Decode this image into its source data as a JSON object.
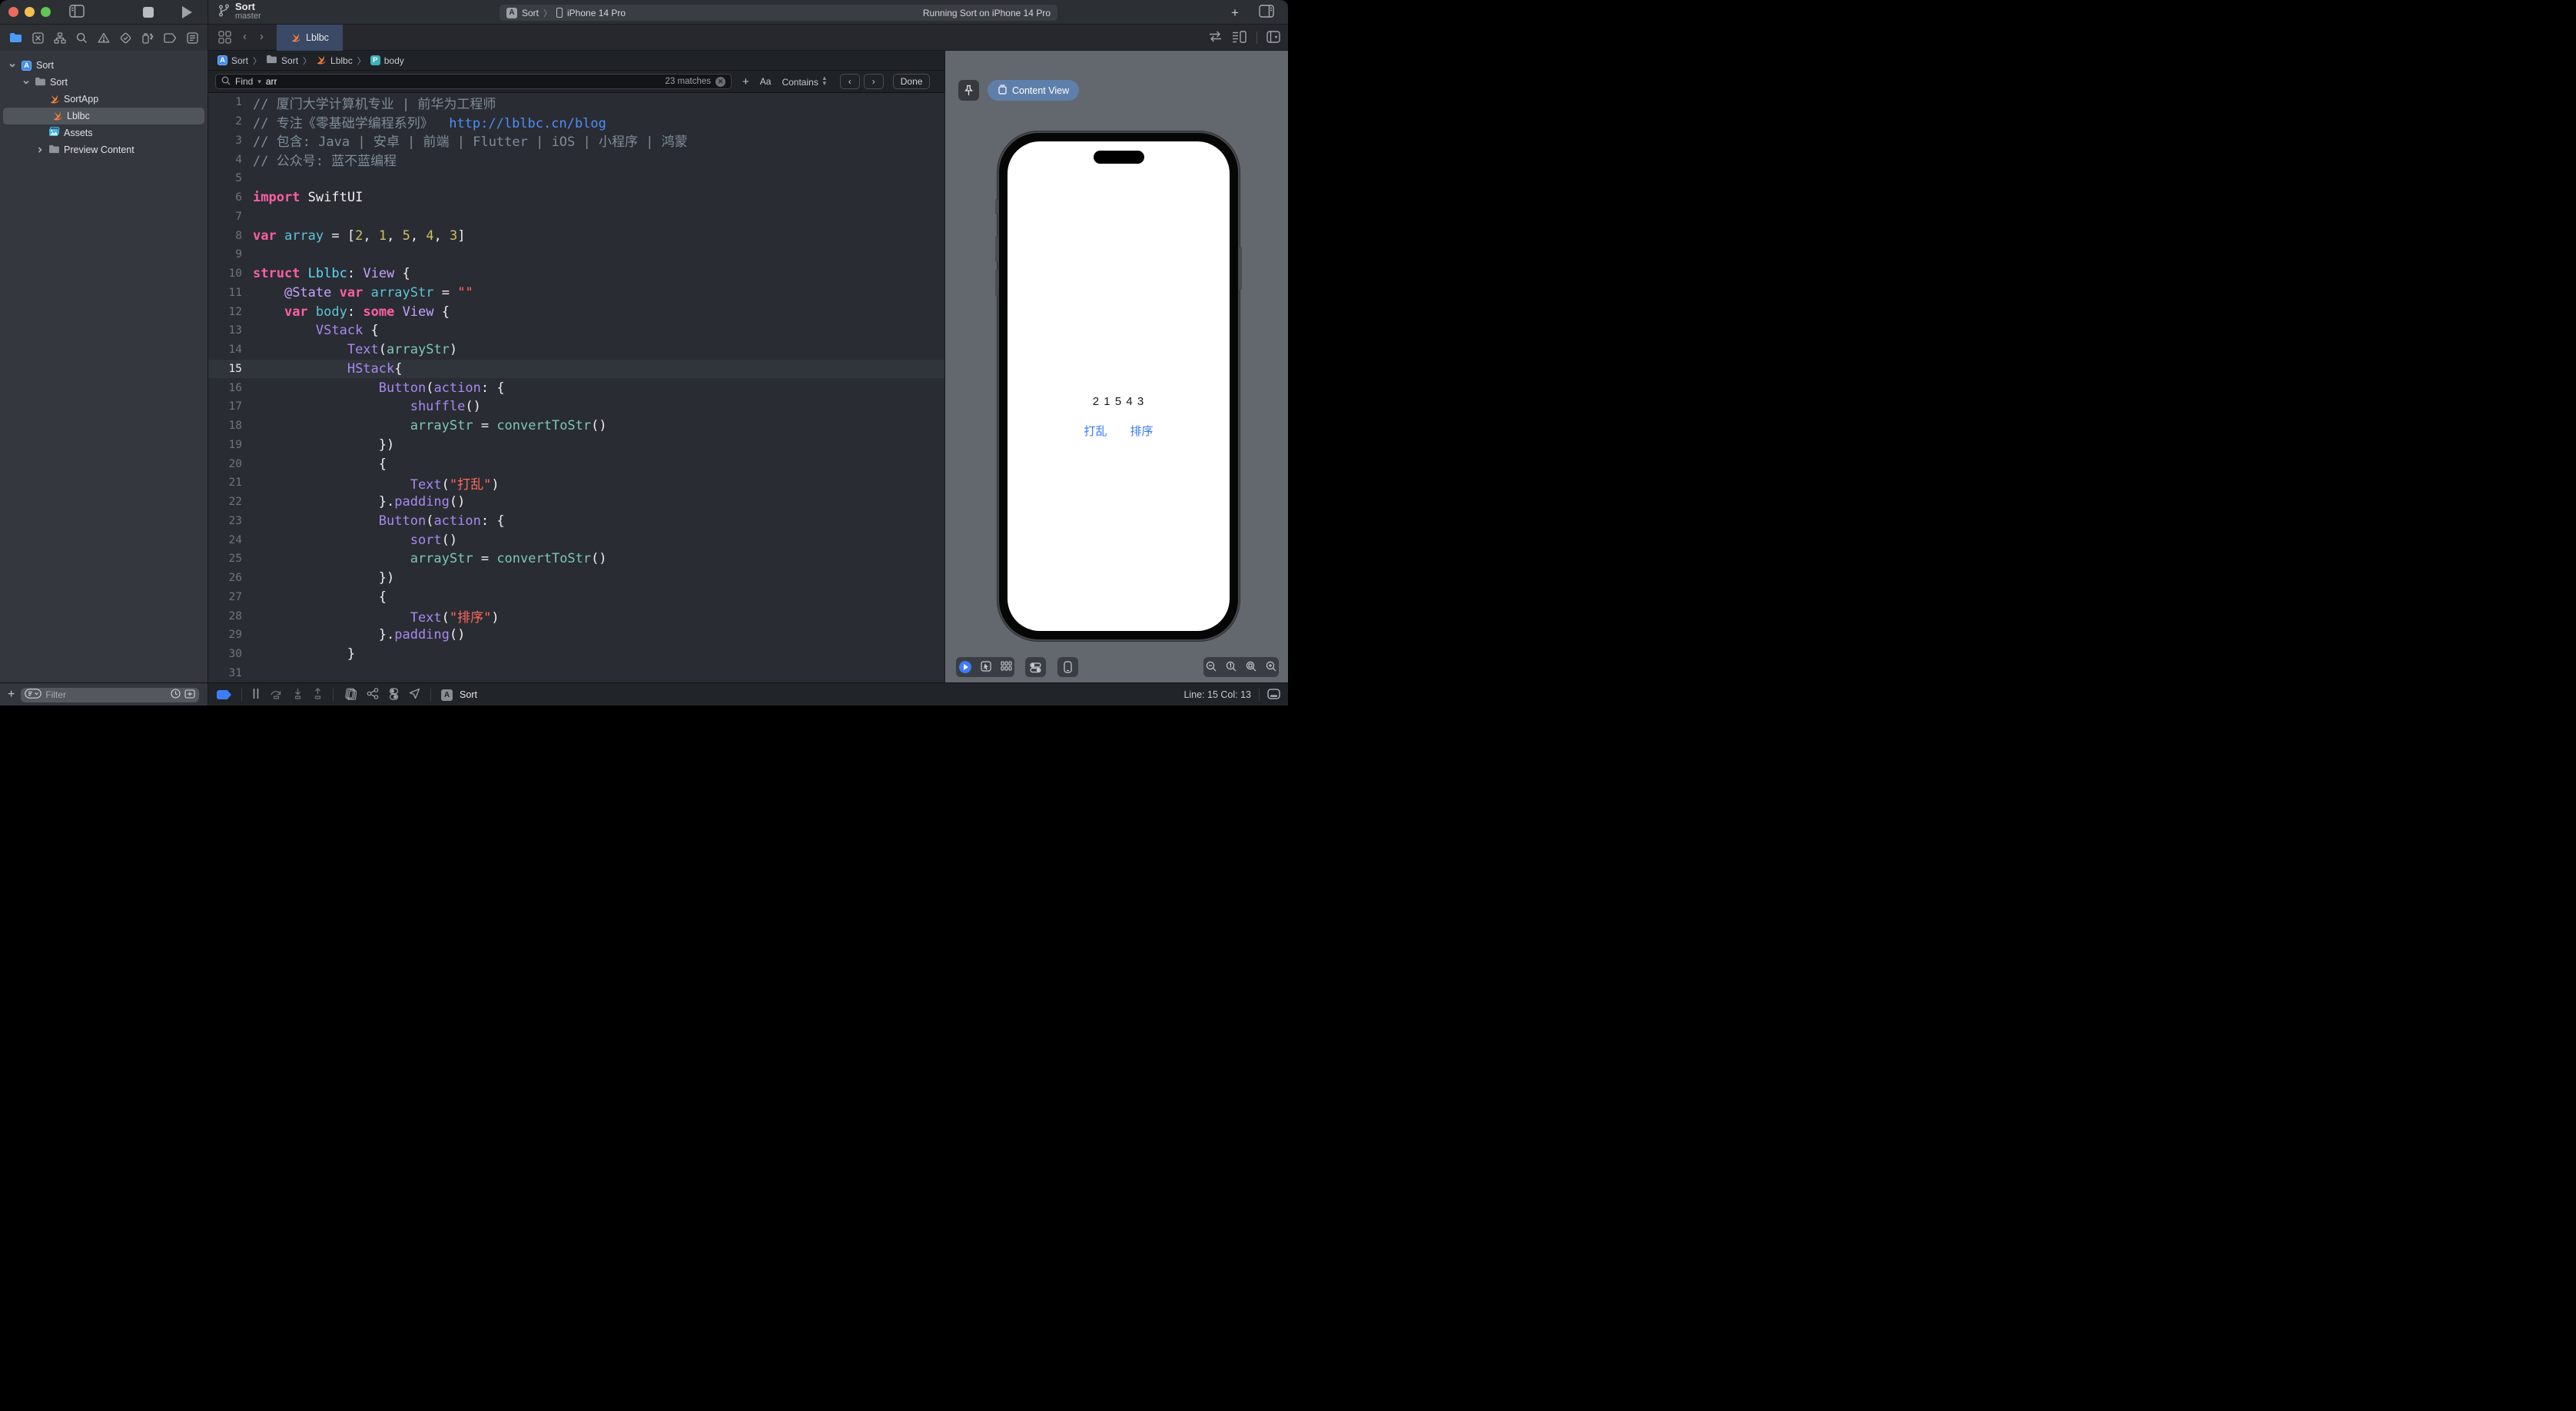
{
  "titlebar": {
    "project": "Sort",
    "branch": "master",
    "status_project": "Sort",
    "status_device": "iPhone 14 Pro",
    "status_right": "Running Sort on iPhone 14 Pro"
  },
  "navigator": {
    "items": [
      {
        "label": "Sort",
        "type": "project",
        "level": 0,
        "chevron": "down"
      },
      {
        "label": "Sort",
        "type": "folder",
        "level": 1,
        "chevron": "down"
      },
      {
        "label": "SortApp",
        "type": "swift",
        "level": 2,
        "chevron": "none"
      },
      {
        "label": "Lblbc",
        "type": "swift",
        "level": 2,
        "chevron": "none",
        "selected": true
      },
      {
        "label": "Assets",
        "type": "assets",
        "level": 2,
        "chevron": "none"
      },
      {
        "label": "Preview Content",
        "type": "folder",
        "level": 2,
        "chevron": "right"
      }
    ],
    "filter_placeholder": "Filter"
  },
  "tabbar": {
    "tabs": [
      {
        "label": "Lblbc",
        "active": true
      }
    ]
  },
  "jumpbar": {
    "crumbs": [
      {
        "label": "Sort",
        "icon": "app"
      },
      {
        "label": "Sort",
        "icon": "folder"
      },
      {
        "label": "Lblbc",
        "icon": "swift"
      },
      {
        "label": "body",
        "icon": "property"
      }
    ]
  },
  "findbar": {
    "mode_label": "Find",
    "query": "arr",
    "matches_text": "23 matches",
    "case_toggle_label": "Aa",
    "match_style_label": "Contains",
    "done_label": "Done"
  },
  "editor": {
    "current_line": 15,
    "colors": {
      "comment": "#7F8C98",
      "url": "#4E8EF7",
      "kw": "#FC5FA3",
      "plain": "#EFEFF0",
      "decl": "#5EC4D8",
      "type": "#5DD8FF",
      "purple": "#A989F2",
      "lpurple": "#C7A2FD",
      "mint": "#7EC8B4",
      "num": "#D0BF69",
      "str": "#FC6A5D"
    },
    "lines": [
      {
        "n": 1,
        "seg": [
          [
            "// 厦门大学计算机专业 | 前华为工程师",
            "comment"
          ]
        ]
      },
      {
        "n": 2,
        "seg": [
          [
            "// 专注《零基础学编程系列》  ",
            "comment"
          ],
          [
            "http://lblbc.cn/blog",
            "url"
          ]
        ]
      },
      {
        "n": 3,
        "seg": [
          [
            "// 包含: Java | 安卓 | 前端 | Flutter | iOS | 小程序 | 鸿蒙",
            "comment"
          ]
        ]
      },
      {
        "n": 4,
        "seg": [
          [
            "// 公众号: 蓝不蓝编程",
            "comment"
          ]
        ]
      },
      {
        "n": 5,
        "seg": []
      },
      {
        "n": 6,
        "seg": [
          [
            "import",
            "kw"
          ],
          [
            " SwiftUI",
            "plain"
          ]
        ]
      },
      {
        "n": 7,
        "seg": []
      },
      {
        "n": 8,
        "seg": [
          [
            "var",
            "kw"
          ],
          [
            " ",
            "plain"
          ],
          [
            "array",
            "decl"
          ],
          [
            " = [",
            "plain"
          ],
          [
            "2",
            "num"
          ],
          [
            ", ",
            "plain"
          ],
          [
            "1",
            "num"
          ],
          [
            ", ",
            "plain"
          ],
          [
            "5",
            "num"
          ],
          [
            ", ",
            "plain"
          ],
          [
            "4",
            "num"
          ],
          [
            ", ",
            "plain"
          ],
          [
            "3",
            "num"
          ],
          [
            "]",
            "plain"
          ]
        ]
      },
      {
        "n": 9,
        "seg": []
      },
      {
        "n": 10,
        "seg": [
          [
            "struct",
            "kw"
          ],
          [
            " ",
            "plain"
          ],
          [
            "Lblbc",
            "type"
          ],
          [
            ": ",
            "plain"
          ],
          [
            "View",
            "lpurple"
          ],
          [
            " {",
            "plain"
          ]
        ]
      },
      {
        "n": 11,
        "seg": [
          [
            "    ",
            "plain"
          ],
          [
            "@State",
            "lpurple"
          ],
          [
            " ",
            "plain"
          ],
          [
            "var",
            "kw"
          ],
          [
            " ",
            "plain"
          ],
          [
            "arrayStr",
            "decl"
          ],
          [
            " = ",
            "plain"
          ],
          [
            "\"\"",
            "str"
          ]
        ]
      },
      {
        "n": 12,
        "seg": [
          [
            "    ",
            "plain"
          ],
          [
            "var",
            "kw"
          ],
          [
            " ",
            "plain"
          ],
          [
            "body",
            "decl"
          ],
          [
            ": ",
            "plain"
          ],
          [
            "some",
            "kw"
          ],
          [
            " ",
            "plain"
          ],
          [
            "View",
            "lpurple"
          ],
          [
            " {",
            "plain"
          ]
        ]
      },
      {
        "n": 13,
        "seg": [
          [
            "        ",
            "plain"
          ],
          [
            "VStack",
            "purple"
          ],
          [
            " {",
            "plain"
          ]
        ]
      },
      {
        "n": 14,
        "seg": [
          [
            "            ",
            "plain"
          ],
          [
            "Text",
            "purple"
          ],
          [
            "(",
            "plain"
          ],
          [
            "arrayStr",
            "mint"
          ],
          [
            ")",
            "plain"
          ]
        ]
      },
      {
        "n": 15,
        "seg": [
          [
            "            ",
            "plain"
          ],
          [
            "HStack",
            "purple"
          ],
          [
            "{",
            "plain"
          ]
        ]
      },
      {
        "n": 16,
        "seg": [
          [
            "                ",
            "plain"
          ],
          [
            "Button",
            "purple"
          ],
          [
            "(",
            "plain"
          ],
          [
            "action",
            "purple"
          ],
          [
            ": {",
            "plain"
          ]
        ]
      },
      {
        "n": 17,
        "seg": [
          [
            "                    ",
            "plain"
          ],
          [
            "shuffle",
            "purple"
          ],
          [
            "()",
            "plain"
          ]
        ]
      },
      {
        "n": 18,
        "seg": [
          [
            "                    ",
            "plain"
          ],
          [
            "arrayStr",
            "mint"
          ],
          [
            " = ",
            "plain"
          ],
          [
            "convertToStr",
            "mint"
          ],
          [
            "()",
            "plain"
          ]
        ]
      },
      {
        "n": 19,
        "seg": [
          [
            "                })",
            "plain"
          ]
        ]
      },
      {
        "n": 20,
        "seg": [
          [
            "                {",
            "plain"
          ]
        ]
      },
      {
        "n": 21,
        "seg": [
          [
            "                    ",
            "plain"
          ],
          [
            "Text",
            "purple"
          ],
          [
            "(",
            "plain"
          ],
          [
            "\"打乱\"",
            "str"
          ],
          [
            ")",
            "plain"
          ]
        ]
      },
      {
        "n": 22,
        "seg": [
          [
            "                }.",
            "plain"
          ],
          [
            "padding",
            "purple"
          ],
          [
            "()",
            "plain"
          ]
        ]
      },
      {
        "n": 23,
        "seg": [
          [
            "                ",
            "plain"
          ],
          [
            "Button",
            "purple"
          ],
          [
            "(",
            "plain"
          ],
          [
            "action",
            "purple"
          ],
          [
            ": {",
            "plain"
          ]
        ]
      },
      {
        "n": 24,
        "seg": [
          [
            "                    ",
            "plain"
          ],
          [
            "sort",
            "purple"
          ],
          [
            "()",
            "plain"
          ]
        ]
      },
      {
        "n": 25,
        "seg": [
          [
            "                    ",
            "plain"
          ],
          [
            "arrayStr",
            "mint"
          ],
          [
            " = ",
            "plain"
          ],
          [
            "convertToStr",
            "mint"
          ],
          [
            "()",
            "plain"
          ]
        ]
      },
      {
        "n": 26,
        "seg": [
          [
            "                })",
            "plain"
          ]
        ]
      },
      {
        "n": 27,
        "seg": [
          [
            "                {",
            "plain"
          ]
        ]
      },
      {
        "n": 28,
        "seg": [
          [
            "                    ",
            "plain"
          ],
          [
            "Text",
            "purple"
          ],
          [
            "(",
            "plain"
          ],
          [
            "\"排序\"",
            "str"
          ],
          [
            ")",
            "plain"
          ]
        ]
      },
      {
        "n": 29,
        "seg": [
          [
            "                }.",
            "plain"
          ],
          [
            "padding",
            "purple"
          ],
          [
            "()",
            "plain"
          ]
        ]
      },
      {
        "n": 30,
        "seg": [
          [
            "            }",
            "plain"
          ]
        ]
      },
      {
        "n": 31,
        "seg": []
      }
    ]
  },
  "debugbar": {
    "app_label": "Sort"
  },
  "statusbar": {
    "line_col": "Line: 15  Col: 13"
  },
  "canvas": {
    "preview_pill_label": "Content View",
    "screen": {
      "array_text": "2 1 5 4 3",
      "buttons": [
        "打乱",
        "排序"
      ],
      "button_color": "#3478F6"
    }
  }
}
